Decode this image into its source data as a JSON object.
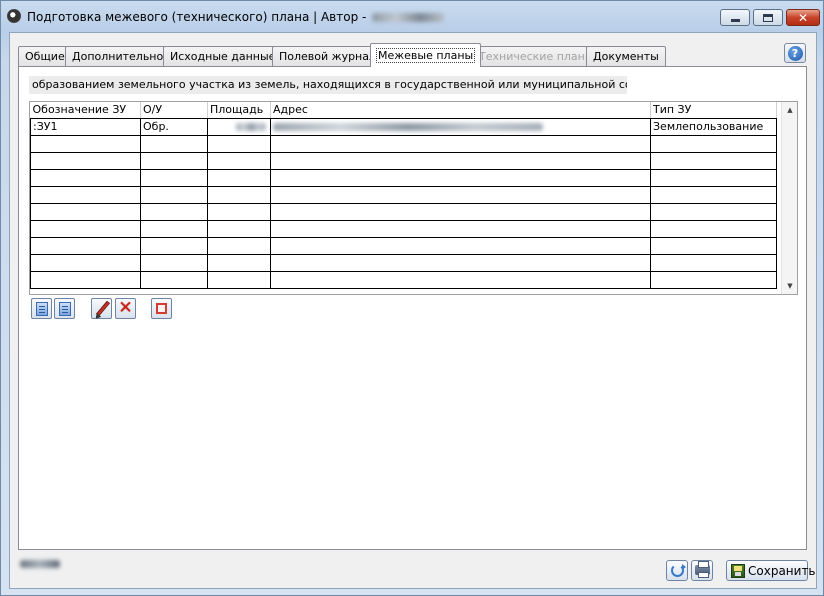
{
  "window": {
    "title": "Подготовка межевого (технического) плана | Автор - ",
    "controls": {
      "minimize": "—",
      "maximize": "□",
      "close": "✕"
    }
  },
  "tabs": [
    {
      "label": "Общие",
      "state": "normal"
    },
    {
      "label": "Дополнительно",
      "state": "normal"
    },
    {
      "label": "Исходные данные",
      "state": "normal"
    },
    {
      "label": "Полевой журнал",
      "state": "normal"
    },
    {
      "label": "Межевые планы",
      "state": "active"
    },
    {
      "label": "Технические планы",
      "state": "disabled"
    },
    {
      "label": "Документы",
      "state": "normal"
    }
  ],
  "help": {
    "label": "?"
  },
  "panel": {
    "description": "образованием земельного участка из земель, находящихся в государственной или муниципальной собственности"
  },
  "grid": {
    "columns": [
      "Обозначение ЗУ",
      "О/У",
      "Площадь",
      "Адрес",
      "Тип ЗУ"
    ],
    "rows": [
      [
        ":ЗУ1",
        "Обр.",
        "",
        "",
        "Землепользование"
      ],
      [
        "",
        "",
        "",
        "",
        ""
      ],
      [
        "",
        "",
        "",
        "",
        ""
      ],
      [
        "",
        "",
        "",
        "",
        ""
      ],
      [
        "",
        "",
        "",
        "",
        ""
      ],
      [
        "",
        "",
        "",
        "",
        ""
      ],
      [
        "",
        "",
        "",
        "",
        ""
      ],
      [
        "",
        "",
        "",
        "",
        ""
      ],
      [
        "",
        "",
        "",
        "",
        ""
      ],
      [
        "",
        "",
        "",
        "",
        ""
      ]
    ],
    "scroll": {
      "up": "▲",
      "down": "▼"
    }
  },
  "toolbar": {
    "buttons": [
      "document-icon",
      "document-list-icon",
      "pencil-icon",
      "delete-x-icon",
      "square-icon"
    ]
  },
  "footer": {
    "save_label": "Сохранить"
  },
  "colors": {
    "window_frame": "#b9cee8",
    "client": "#f0f0f0",
    "panel": "#ffffff",
    "close_button": "#c8442b"
  }
}
